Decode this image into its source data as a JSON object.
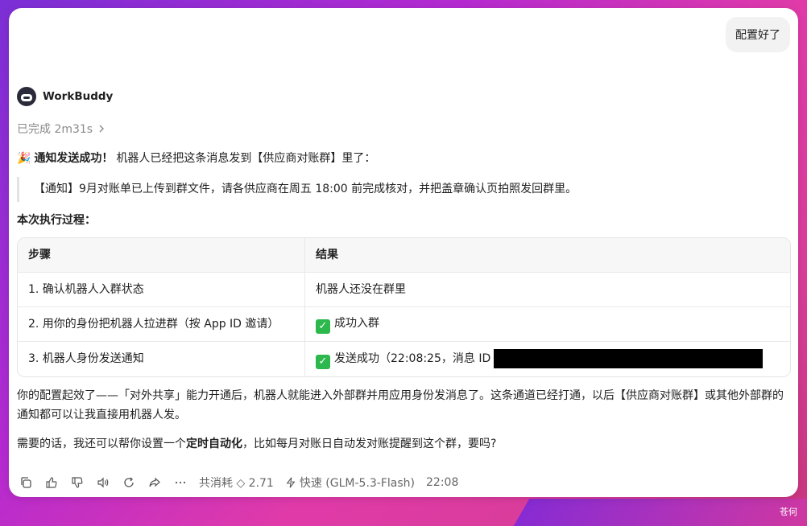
{
  "user_message": "配置好了",
  "bot": {
    "name": "WorkBuddy",
    "status": "已完成 2m31s"
  },
  "reply": {
    "emoji": "🎉",
    "headline_bold": "通知发送成功！",
    "headline_rest": " 机器人已经把这条消息发到【供应商对账群】里了：",
    "quote": "【通知】9月对账单已上传到群文件，请各供应商在周五 18:00 前完成核对，并把盖章确认页拍照发回群里。",
    "section_title": "本次执行过程：",
    "table": {
      "headers": [
        "步骤",
        "结果"
      ],
      "rows": [
        {
          "step": "1. 确认机器人入群状态",
          "result": "机器人还没在群里",
          "check": false
        },
        {
          "step": "2. 用你的身份把机器人拉进群（按 App ID 邀请）",
          "result": "成功入群",
          "check": true
        },
        {
          "step": "3. 机器人身份发送通知",
          "result": "发送成功（22:08:25，消息 ID",
          "check": true
        }
      ]
    },
    "para1": "你的配置起效了——「对外共享」能力开通后，机器人就能进入外部群并用应用身份发消息了。这条通道已经打通，以后【供应商对账群】或其他外部群的通知都可以让我直接用机器人发。",
    "para2_pre": "需要的话，我还可以帮你设置一个",
    "para2_bold": "定时自动化",
    "para2_post": "，比如每月对账日自动发对账提醒到这个群，要吗?"
  },
  "toolbar": {
    "cost": "共消耗 ◇ 2.71",
    "model": "快速 (GLM-5.3-Flash)",
    "time": "22:08"
  },
  "watermark": "苍何"
}
